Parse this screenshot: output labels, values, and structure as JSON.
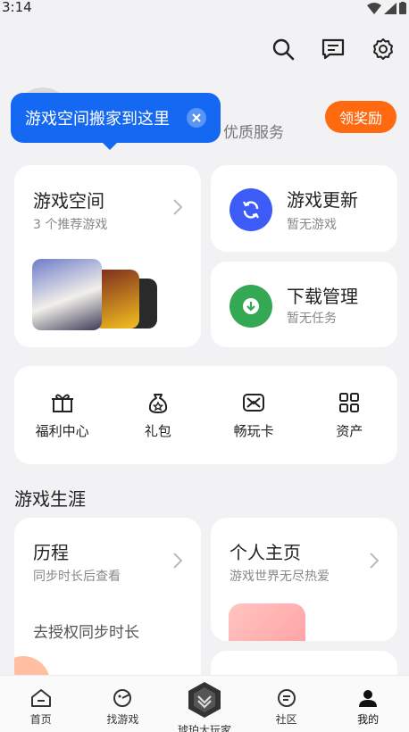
{
  "status_bar": {
    "time": "3:14"
  },
  "top_actions": [
    {
      "icon": "search-icon"
    },
    {
      "icon": "message-icon"
    },
    {
      "icon": "gear-icon"
    }
  ],
  "profile": {
    "subtitle": "优质服务",
    "reward_label": "领奖励"
  },
  "tooltip": {
    "text": "游戏空间搬家到这里"
  },
  "game_space": {
    "title": "游戏空间",
    "subtitle": "3 个推荐游戏"
  },
  "game_update": {
    "title": "游戏更新",
    "subtitle": "暂无游戏"
  },
  "download_mgr": {
    "title": "下载管理",
    "subtitle": "暂无任务"
  },
  "quick_links": [
    {
      "label": "福利中心",
      "icon": "gift-box-icon"
    },
    {
      "label": "礼包",
      "icon": "gift-bag-icon"
    },
    {
      "label": "畅玩卡",
      "icon": "card-icon"
    },
    {
      "label": "资产",
      "icon": "grid-icon"
    }
  ],
  "career": {
    "section_title": "游戏生涯",
    "history": {
      "title": "历程",
      "subtitle": "同步时长后查看",
      "link": "去授权同步时长"
    },
    "homepage": {
      "title": "个人主页",
      "subtitle": "游戏世界无尽热爱"
    }
  },
  "bottom_nav": [
    {
      "label": "首页",
      "icon": "home-icon"
    },
    {
      "label": "找游戏",
      "icon": "find-game-icon"
    },
    {
      "label": "琥珀大玩家",
      "icon": "amber-badge-icon"
    },
    {
      "label": "社区",
      "icon": "community-icon"
    },
    {
      "label": "我的",
      "icon": "profile-icon",
      "active": true
    }
  ],
  "colors": {
    "accent_blue": "#1468f2",
    "reward_orange": "#ff6a10",
    "update_blue": "#3d5bf6",
    "download_green": "#34a853"
  }
}
